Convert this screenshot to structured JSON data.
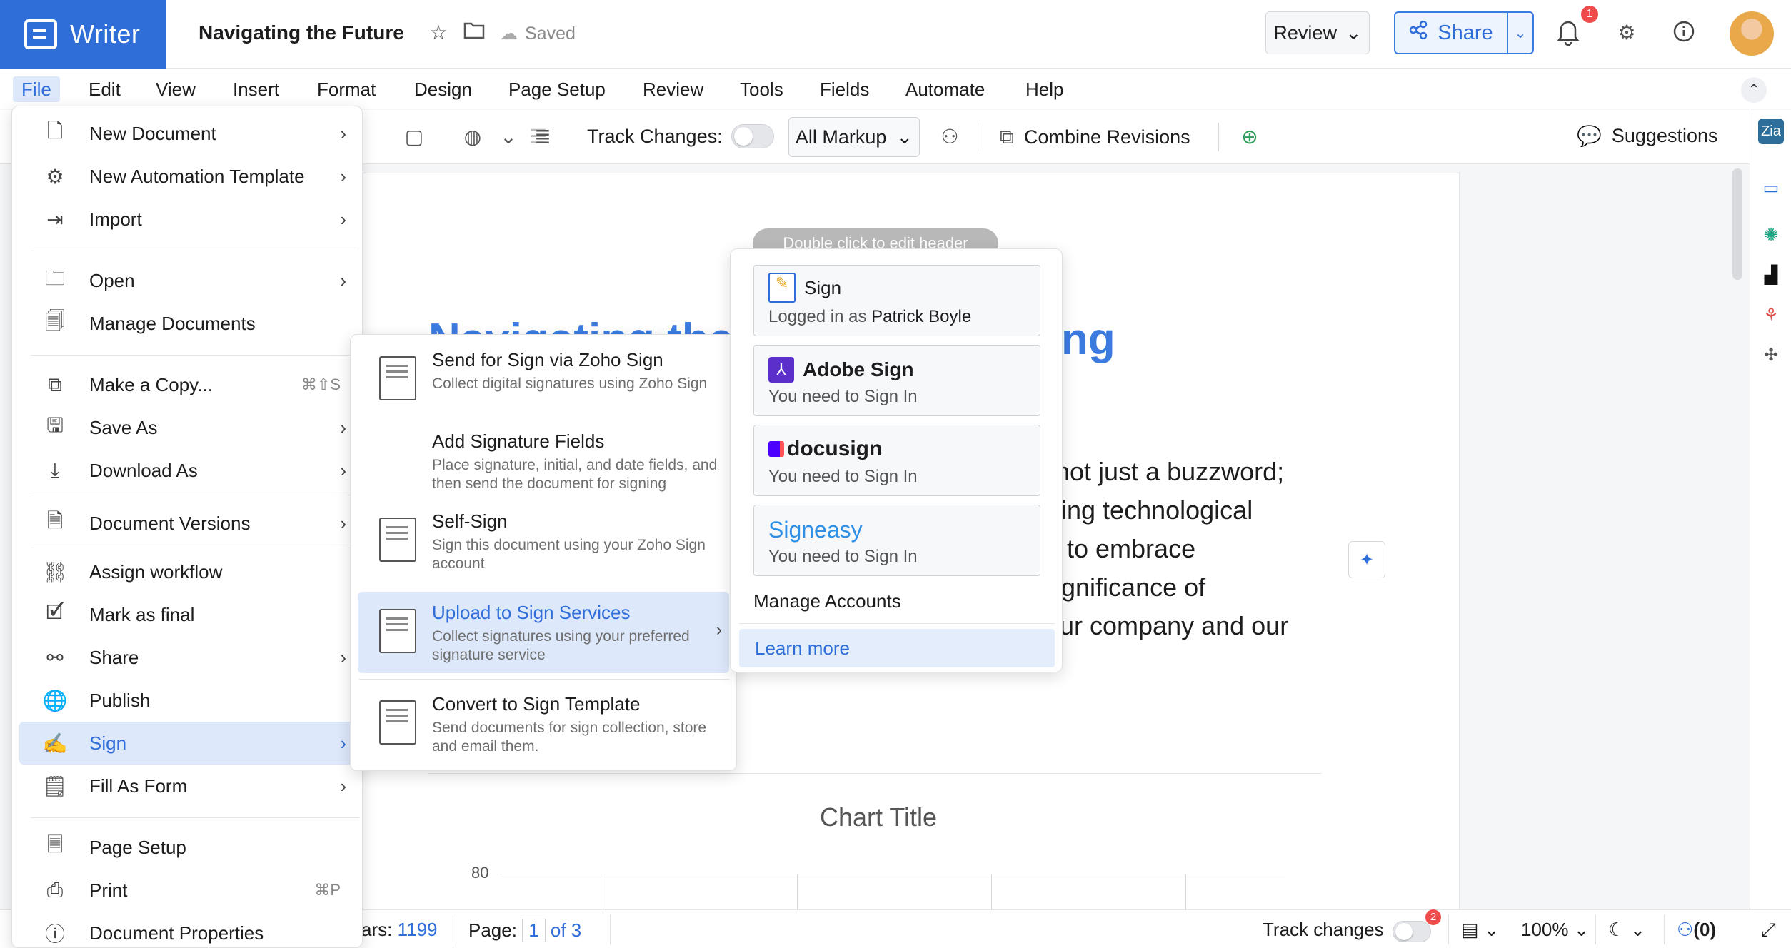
{
  "app": {
    "name": "Writer",
    "doc_title": "Navigating the Future",
    "save_status": "Saved",
    "notifications": "1"
  },
  "header": {
    "review": "Review",
    "share": "Share"
  },
  "menubar": [
    "File",
    "Edit",
    "View",
    "Insert",
    "Format",
    "Design",
    "Page Setup",
    "Review",
    "Tools",
    "Fields",
    "Automate",
    "Help"
  ],
  "toolbar": {
    "track_changes": "Track Changes:",
    "markup": "All Markup",
    "combine": "Combine Revisions",
    "suggestions": "Suggestions"
  },
  "file_menu": {
    "items": [
      {
        "label": "New Document",
        "arrow": "›"
      },
      {
        "label": "New Automation Template",
        "arrow": "›"
      },
      {
        "label": "Import",
        "arrow": "›"
      },
      {
        "label": "Open",
        "arrow": "›"
      },
      {
        "label": "Manage Documents",
        "arrow": ""
      },
      {
        "label": "Make a Copy...",
        "shortcut": "⌘⇧S"
      },
      {
        "label": "Save As",
        "arrow": "›"
      },
      {
        "label": "Download As",
        "arrow": "›"
      },
      {
        "label": "Document Versions",
        "arrow": "›"
      },
      {
        "label": "Assign workflow",
        "arrow": ""
      },
      {
        "label": "Mark as final",
        "arrow": ""
      },
      {
        "label": "Share",
        "arrow": "›"
      },
      {
        "label": "Publish",
        "arrow": ""
      },
      {
        "label": "Sign",
        "arrow": "›"
      },
      {
        "label": "Fill As Form",
        "arrow": "›"
      },
      {
        "label": "Page Setup",
        "arrow": ""
      },
      {
        "label": "Print",
        "shortcut": "⌘P"
      },
      {
        "label": "Document Properties",
        "arrow": ""
      }
    ]
  },
  "sign_menu": {
    "items": [
      {
        "title": "Send for Sign via Zoho Sign",
        "desc": "Collect digital signatures using Zoho Sign"
      },
      {
        "title": "Add Signature Fields",
        "desc": "Place signature, initial, and date fields, and then send the document for signing"
      },
      {
        "title": "Self-Sign",
        "desc": "Sign this document using your Zoho Sign account"
      },
      {
        "title": "Upload to Sign Services",
        "desc": "Collect signatures using your preferred signature service"
      },
      {
        "title": "Convert to Sign Template",
        "desc": "Send documents for sign collection, store and email them."
      }
    ]
  },
  "services": {
    "zoho": {
      "name": "Sign",
      "logged_prefix": "Logged in as",
      "user": "Patrick Boyle"
    },
    "adobe": {
      "name": "Adobe Sign",
      "status": "You need to Sign In"
    },
    "docusign": {
      "name": "docusign",
      "status": "You need to Sign In"
    },
    "signeasy": {
      "name": "Signeasy",
      "status": "You need to Sign In"
    },
    "manage": "Manage Accounts",
    "learn": "Learn more"
  },
  "document": {
    "header_hint": "Double click to edit header",
    "heading_start": "Navigating the",
    "heading_end": "ng",
    "lines": [
      "not just a buzzword;",
      "ing technological",
      "to embrace",
      "gnificance of",
      "ur company and our"
    ],
    "chart_title": "Chart Title",
    "chart_tick": "80"
  },
  "status": {
    "chars_label": "ars:",
    "chars": "1199",
    "page_label": "Page:",
    "page": "1",
    "of": "of 3",
    "track": "Track changes",
    "track_badge": "2",
    "zoom": "100%",
    "collab": "(0)"
  }
}
